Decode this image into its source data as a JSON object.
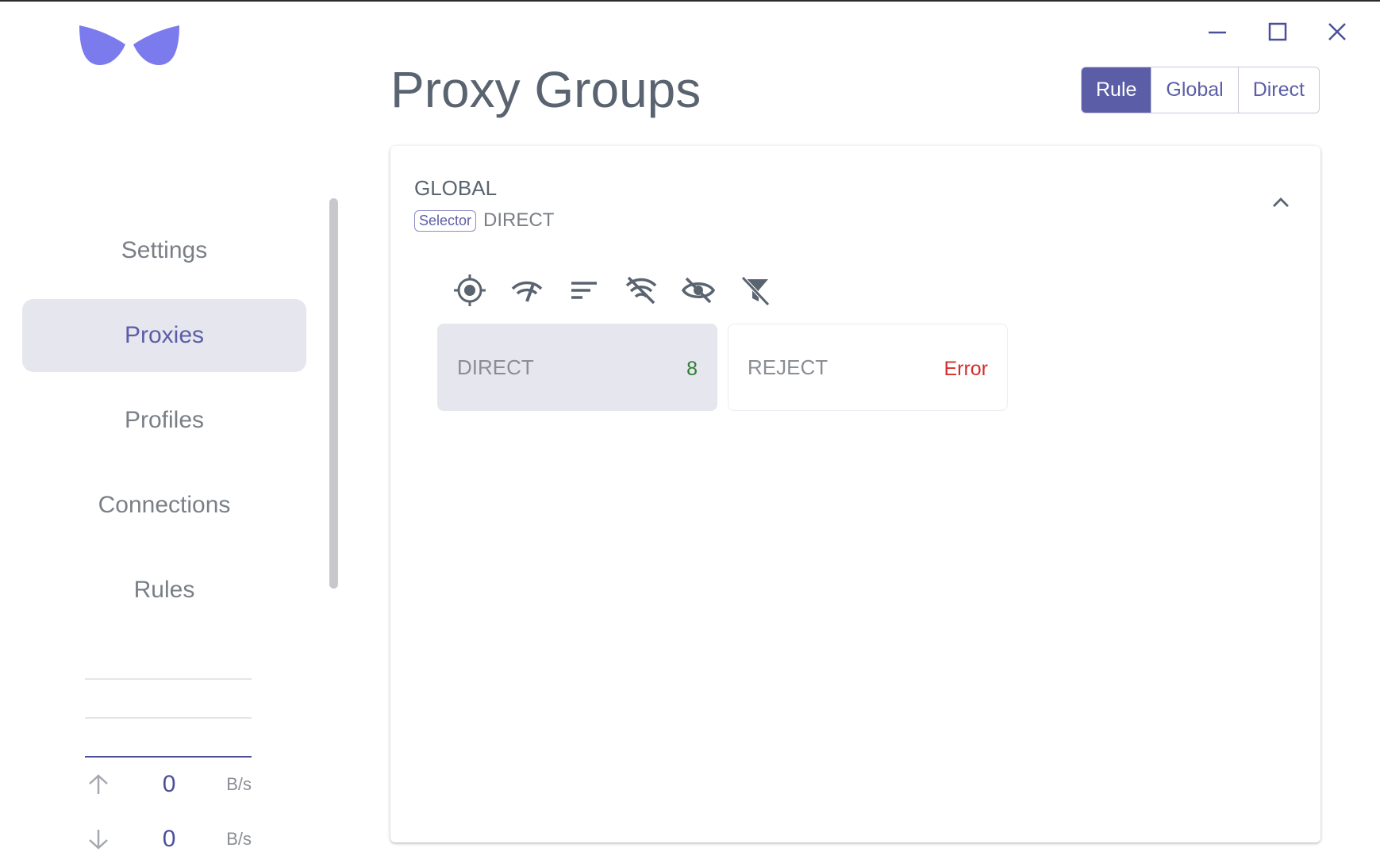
{
  "sidebar": {
    "items": [
      {
        "label": "Settings"
      },
      {
        "label": "Proxies"
      },
      {
        "label": "Profiles"
      },
      {
        "label": "Connections"
      },
      {
        "label": "Rules"
      }
    ],
    "active": "Proxies"
  },
  "traffic": {
    "upload": {
      "value": "0",
      "unit": "B/s"
    },
    "download": {
      "value": "0",
      "unit": "B/s"
    }
  },
  "header": {
    "title": "Proxy Groups",
    "modes": [
      {
        "label": "Rule",
        "active": true
      },
      {
        "label": "Global",
        "active": false
      },
      {
        "label": "Direct",
        "active": false
      }
    ]
  },
  "group": {
    "name": "GLOBAL",
    "type": "Selector",
    "now": "DIRECT",
    "toolbar_icons": [
      "locate-icon",
      "speed-test-icon",
      "sort-icon",
      "filter-no-delay-icon",
      "hide-unavailable-icon",
      "filter-off-icon"
    ],
    "proxies": [
      {
        "name": "DIRECT",
        "delay": "8",
        "selected": true
      },
      {
        "name": "REJECT",
        "delay": "Error",
        "selected": false
      }
    ]
  },
  "colors": {
    "accent": "#5b5ea6",
    "logo": "#7b7bed",
    "delay_ok": "#2e7d32",
    "delay_error": "#d32f2f",
    "selected_bg": "#e6e6ef"
  }
}
